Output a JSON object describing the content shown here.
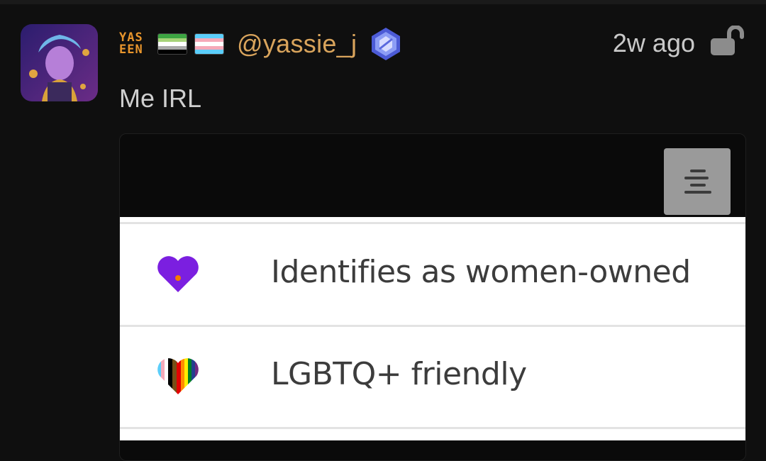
{
  "post": {
    "username": "@yassie_j",
    "timestamp": "2w ago",
    "text": "Me IRL",
    "badge_text_top": "YAS",
    "badge_text_bottom": "EEN"
  },
  "flags": {
    "aromantic": [
      "#3da542",
      "#a7d379",
      "#ffffff",
      "#a9a9a9",
      "#000000"
    ],
    "transgender": [
      "#5bcefa",
      "#f5a9b8",
      "#ffffff",
      "#f5a9b8",
      "#5bcefa"
    ]
  },
  "colors": {
    "username": "#d9a45c",
    "women_owned_heart": "#7b1fe0",
    "women_owned_dot": "#f57c00"
  },
  "attributes": [
    {
      "label": "Identifies as women-owned",
      "icon": "purple-heart-icon"
    },
    {
      "label": "LGBTQ+ friendly",
      "icon": "rainbow-heart-icon"
    }
  ]
}
